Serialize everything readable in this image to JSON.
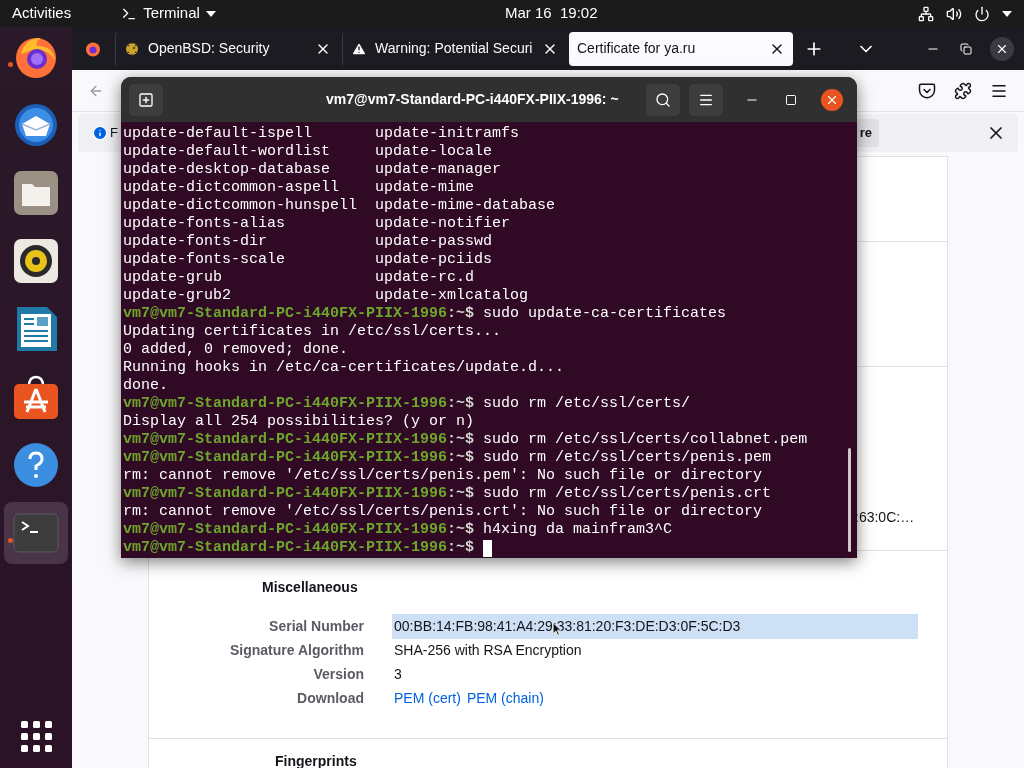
{
  "top_bar": {
    "activities": "Activities",
    "app_menu": "Terminal",
    "clock": "Mar 16  19:02"
  },
  "dock": {
    "items": [
      {
        "running": true,
        "selected": false
      },
      {
        "running": false,
        "selected": false
      },
      {
        "running": false,
        "selected": false
      },
      {
        "running": false,
        "selected": false
      },
      {
        "running": false,
        "selected": false
      },
      {
        "running": false,
        "selected": false
      },
      {
        "running": false,
        "selected": false
      },
      {
        "running": true,
        "selected": true
      }
    ]
  },
  "browser": {
    "tabs": [
      {
        "title": "OpenBSD: Security",
        "selected": false
      },
      {
        "title": "Warning: Potential Securi",
        "selected": false
      },
      {
        "title": "Certificate for ya.ru",
        "selected": true
      }
    ],
    "notification": {
      "text": "F",
      "button": "re"
    },
    "page": {
      "partial_value": ":63:0C:…",
      "section": {
        "title": "Miscellaneous",
        "rows": [
          {
            "kind": "text",
            "label": "Serial Number",
            "value": "00:BB:14:FB:98:41:A4:29:33:81:20:F3:DE:D3:0F:5C:D3",
            "selected": true
          },
          {
            "kind": "text",
            "label": "Signature Algorithm",
            "value": "SHA-256 with RSA Encryption",
            "selected": false
          },
          {
            "kind": "text",
            "label": "Version",
            "value": "3",
            "selected": false
          },
          {
            "kind": "links",
            "label": "Download",
            "links": [
              "PEM (cert)",
              "PEM (chain)"
            ],
            "selected": false
          }
        ]
      },
      "next_section": "Fingerprints"
    }
  },
  "terminal": {
    "title": "vm7@vm7-Standard-PC-i440FX-PIIX-1996: ~",
    "lines": [
      {
        "kind": "listing",
        "column_1": "update-default-ispell",
        "column_2": "update-initramfs"
      },
      {
        "kind": "listing",
        "column_1": "update-default-wordlist",
        "column_2": "update-locale"
      },
      {
        "kind": "listing",
        "column_1": "update-desktop-database",
        "column_2": "update-manager"
      },
      {
        "kind": "listing",
        "column_1": "update-dictcommon-aspell",
        "column_2": "update-mime"
      },
      {
        "kind": "listing",
        "column_1": "update-dictcommon-hunspell",
        "column_2": "update-mime-database"
      },
      {
        "kind": "listing",
        "column_1": "update-fonts-alias",
        "column_2": "update-notifier"
      },
      {
        "kind": "listing",
        "column_1": "update-fonts-dir",
        "column_2": "update-passwd"
      },
      {
        "kind": "listing",
        "column_1": "update-fonts-scale",
        "column_2": "update-pciids"
      },
      {
        "kind": "listing",
        "column_1": "update-grub",
        "column_2": "update-rc.d"
      },
      {
        "kind": "listing",
        "column_1": "update-grub2",
        "column_2": "update-xmlcatalog"
      },
      {
        "kind": "prompt",
        "prompt": "vm7@vm7-Standard-PC-i440FX-PIIX-1996",
        "suffix": ":~$",
        "command": "sudo update-ca-certificates",
        "cursor": false
      },
      {
        "kind": "output",
        "text": "Updating certificates in /etc/ssl/certs..."
      },
      {
        "kind": "output",
        "text": "0 added, 0 removed; done."
      },
      {
        "kind": "output",
        "text": "Running hooks in /etc/ca-certificates/update.d..."
      },
      {
        "kind": "output",
        "text": "done."
      },
      {
        "kind": "prompt",
        "prompt": "vm7@vm7-Standard-PC-i440FX-PIIX-1996",
        "suffix": ":~$",
        "command": "sudo rm /etc/ssl/certs/",
        "cursor": false
      },
      {
        "kind": "output",
        "text": "Display all 254 possibilities? (y or n)"
      },
      {
        "kind": "prompt",
        "prompt": "vm7@vm7-Standard-PC-i440FX-PIIX-1996",
        "suffix": ":~$",
        "command": "sudo rm /etc/ssl/certs/collabnet.pem",
        "cursor": false
      },
      {
        "kind": "prompt",
        "prompt": "vm7@vm7-Standard-PC-i440FX-PIIX-1996",
        "suffix": ":~$",
        "command": "sudo rm /etc/ssl/certs/penis.pem",
        "cursor": false
      },
      {
        "kind": "output",
        "text": "rm: cannot remove '/etc/ssl/certs/penis.pem': No such file or directory"
      },
      {
        "kind": "prompt",
        "prompt": "vm7@vm7-Standard-PC-i440FX-PIIX-1996",
        "suffix": ":~$",
        "command": "sudo rm /etc/ssl/certs/penis.crt",
        "cursor": false
      },
      {
        "kind": "output",
        "text": "rm: cannot remove '/etc/ssl/certs/penis.crt': No such file or directory"
      },
      {
        "kind": "prompt",
        "prompt": "vm7@vm7-Standard-PC-i440FX-PIIX-1996",
        "suffix": ":~$",
        "command": "h4xing da mainfram3^C",
        "cursor": false
      },
      {
        "kind": "prompt",
        "prompt": "vm7@vm7-Standard-PC-i440FX-PIIX-1996",
        "suffix": ":~$",
        "cursor": true
      }
    ]
  }
}
